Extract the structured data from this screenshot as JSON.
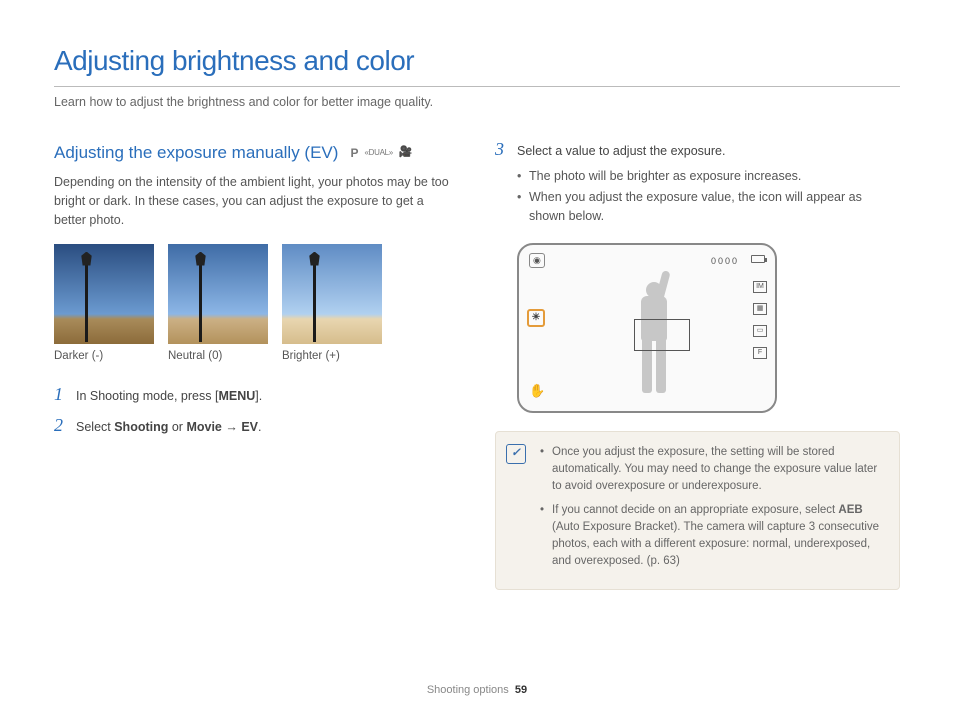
{
  "page_title": "Adjusting brightness and color",
  "intro": "Learn how to adjust the brightness and color for better image quality.",
  "section": {
    "title": "Adjusting the exposure manually (EV)",
    "modes": {
      "p": "P",
      "dual": "DUAL"
    },
    "body": "Depending on the intensity of the ambient light, your photos may be too bright or dark. In these cases, you can adjust the exposure to get a better photo."
  },
  "thumbs": {
    "darker": "Darker (-)",
    "neutral": "Neutral (0)",
    "brighter": "Brighter (+)"
  },
  "steps": {
    "s1_pre": "In Shooting mode, press [",
    "s1_menu": "MENU",
    "s1_post": "].",
    "s2_pre": "Select ",
    "s2_shooting": "Shooting",
    "s2_or": " or ",
    "s2_movie": "Movie",
    "s2_arrow": " → ",
    "s2_ev": "EV",
    "s2_post": ".",
    "s3": "Select a value to adjust the exposure.",
    "s3_b1": "The photo will be brighter as exposure increases.",
    "s3_b2": "When you adjust the exposure value, the icon will appear as shown below."
  },
  "screen": {
    "counter": "0000",
    "ev": "☀",
    "r1": "IM",
    "r3": "F",
    "camera": "◉"
  },
  "note": {
    "n1": "Once you adjust the exposure, the setting will be stored automatically. You may need to change the exposure value later to avoid overexposure or underexposure.",
    "n2_pre": "If you cannot decide on an appropriate exposure, select ",
    "n2_aeb": "AEB",
    "n2_post": " (Auto Exposure Bracket). The camera will capture 3 consecutive photos, each with a different exposure: normal, underexposed, and overexposed. (p. 63)"
  },
  "footer": {
    "section": "Shooting options",
    "page": "59"
  }
}
